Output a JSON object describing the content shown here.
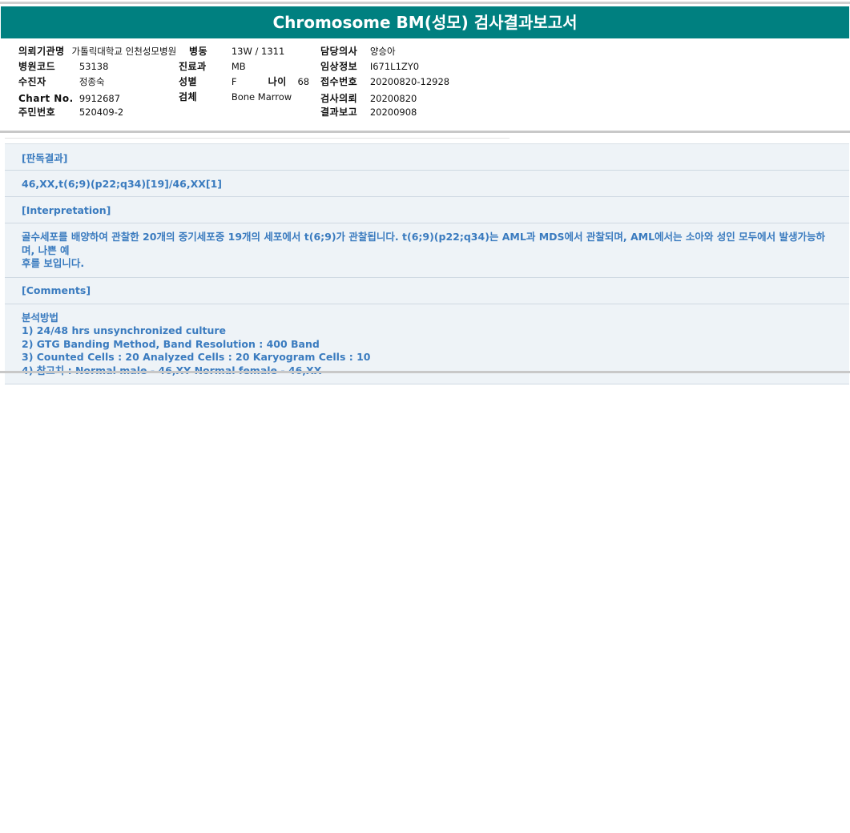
{
  "title": "Chromosome BM(성모) 검사결과보고서",
  "info": {
    "hospital_label": "의뢰기관명",
    "hospital_value": "가톨릭대학교 인천성모병원",
    "ward_label": "병동",
    "ward_value": "13W / 1311",
    "doctor_label": "담당의사",
    "doctor_value": "양승아",
    "hospital_code_label": "병원코드",
    "hospital_code_value": "53138",
    "dept_label": "진료과",
    "dept_value": "MB",
    "clinical_label": "임상정보",
    "clinical_value": "I671L1ZY0",
    "patient_label": "수진자",
    "patient_value": "정종숙",
    "sex_label": "성별",
    "sex_value": "F",
    "age_label": "나이",
    "age_value": "68",
    "receipt_label": "접수번호",
    "receipt_value": "20200820-12928",
    "chart_label": "Chart No.",
    "chart_value": "9912687",
    "specimen_label": "검체",
    "specimen_value": "Bone Marrow",
    "request_label": "검사의뢰",
    "request_value": "20200820",
    "id_label": "주민번호",
    "id_value": "520409-2",
    "report_label": "결과보고",
    "report_value": "20200908"
  },
  "sections": {
    "result_header": "[판독결과]",
    "result_value": "46,XX,t(6;9)(p22;q34)[19]/46,XX[1]",
    "interp_header": "[Interpretation]",
    "interp_line1": "골수세포를 배양하여 관찰한 20개의 중기세포중 19개의 세포에서 t(6;9)가 관찰됩니다. t(6;9)(p22;q34)는 AML과 MDS에서 관찰되며, AML에서는 소아와 성인 모두에서 발생가능하며, 나쁜 예",
    "interp_line2": "후를 보입니다.",
    "comments_header": "[Comments]",
    "comments_lines": [
      "분석방법",
      "1) 24/48 hrs unsynchronized culture",
      "2) GTG Banding Method, Band Resolution : 400 Band",
      "3) Counted Cells : 20 Analyzed Cells : 20 Karyogram Cells : 10",
      "4) 참고치 : Normal male - 46,XY Normal female - 46,XX"
    ]
  },
  "colors": {
    "title_bg": "#008080",
    "text_blue": "#3a7bbf",
    "panel_bg": "#eef3f7"
  }
}
